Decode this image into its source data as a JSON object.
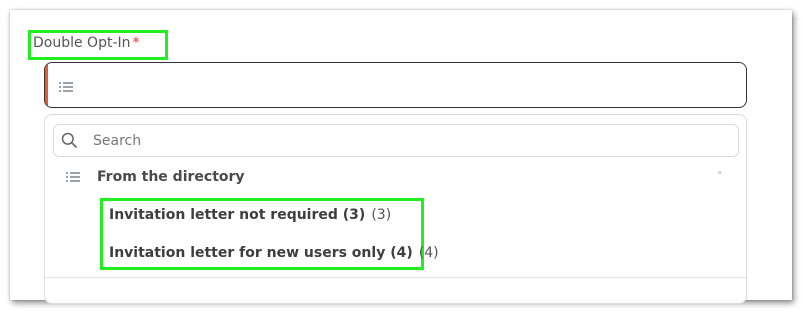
{
  "field": {
    "label": "Double Opt-In",
    "required_mark": "*"
  },
  "search": {
    "placeholder": "Search",
    "value": ""
  },
  "group": {
    "title": "From the directory",
    "collapse_glyph": "ˆ"
  },
  "options": [
    {
      "label": "Invitation letter not required (3)",
      "count": "(3)"
    },
    {
      "label": "Invitation letter for new users only (4)",
      "count": "(4)"
    }
  ],
  "colors": {
    "accent": "#e85a2a",
    "highlight": "#22ee22",
    "required": "#e0333a"
  },
  "icons": {
    "select": "list-icon",
    "search": "search-icon",
    "group": "list-icon",
    "collapse": "chevron-up-icon"
  }
}
